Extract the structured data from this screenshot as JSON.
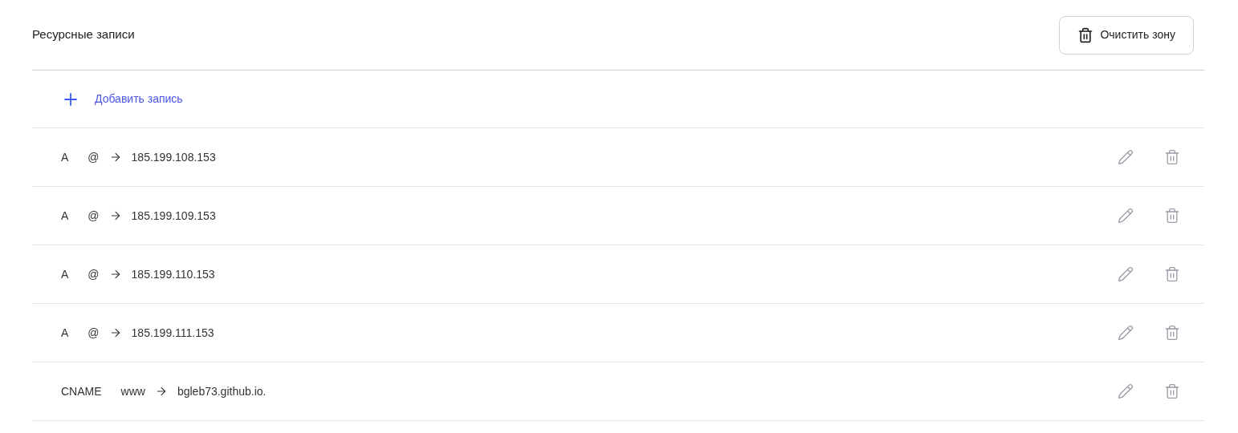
{
  "title": "Ресурсные записи",
  "clear_button": "Очистить зону",
  "add_button": "Добавить запись",
  "records": [
    {
      "type": "A",
      "name": "@",
      "value": "185.199.108.153"
    },
    {
      "type": "A",
      "name": "@",
      "value": "185.199.109.153"
    },
    {
      "type": "A",
      "name": "@",
      "value": "185.199.110.153"
    },
    {
      "type": "A",
      "name": "@",
      "value": "185.199.111.153"
    },
    {
      "type": "CNAME",
      "name": "www",
      "value": "bgleb73.github.io."
    }
  ]
}
